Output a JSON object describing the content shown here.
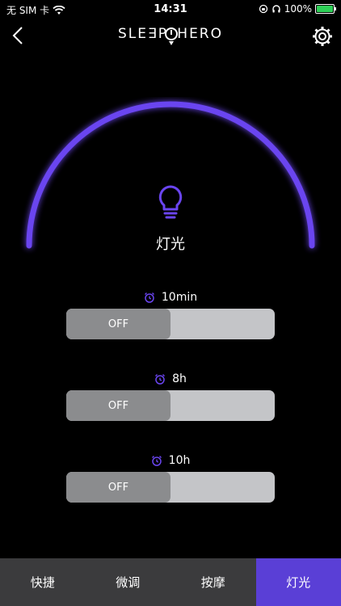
{
  "status_bar": {
    "carrier": "无 SIM 卡",
    "time": "14:31",
    "battery": "100%"
  },
  "header": {
    "logo_left": "SLE∃P",
    "logo_right": "HERO",
    "back_icon": "chevron-left-icon",
    "settings_icon": "gear-icon"
  },
  "main": {
    "mode_title": "灯光",
    "mode_icon": "lightbulb-icon",
    "accent_color": "#6a45f0",
    "timers": [
      {
        "label": "10min",
        "state": "OFF"
      },
      {
        "label": "8h",
        "state": "OFF"
      },
      {
        "label": "10h",
        "state": "OFF"
      }
    ]
  },
  "tabs": [
    {
      "label": "快捷",
      "active": false
    },
    {
      "label": "微调",
      "active": false
    },
    {
      "label": "按摩",
      "active": false
    },
    {
      "label": "灯光",
      "active": true
    }
  ]
}
